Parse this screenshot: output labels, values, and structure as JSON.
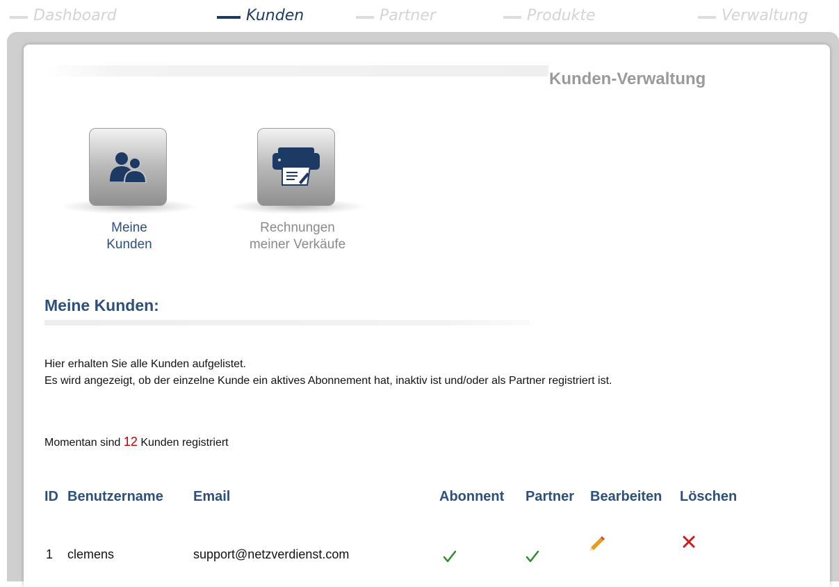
{
  "nav": {
    "items": [
      {
        "label": "Dashboard",
        "active": false
      },
      {
        "label": "Kunden",
        "active": true
      },
      {
        "label": "Partner",
        "active": false
      },
      {
        "label": "Produkte",
        "active": false
      },
      {
        "label": "Verwaltung",
        "active": false
      }
    ]
  },
  "page": {
    "title": "Kunden-Verwaltung"
  },
  "tiles": [
    {
      "label": "Meine\nKunden",
      "icon": "users-icon",
      "active": true
    },
    {
      "label": "Rechnungen\nmeiner Verkäufe",
      "icon": "printer-icon",
      "active": false
    }
  ],
  "section": {
    "title": "Meine Kunden:",
    "intro_line1": "Hier erhalten Sie alle Kunden aufgelistet.",
    "intro_line2": "Es wird angezeigt, ob der einzelne Kunde ein aktives Abonnement hat, inaktiv ist und/oder als Partner registriert ist.",
    "count_prefix": "Momentan sind",
    "count": "12",
    "count_suffix": "Kunden registriert"
  },
  "table": {
    "headers": {
      "id": "ID",
      "username": "Benutzername",
      "email": "Email",
      "abonnent": "Abonnent",
      "partner": "Partner",
      "edit": "Bearbeiten",
      "delete": "Löschen"
    },
    "rows": [
      {
        "id": "1",
        "username": "clemens",
        "email": "support@netzverdienst.com",
        "abonnent": true,
        "partner": true,
        "edit_icon": "pencil-icon",
        "delete_icon": "delete-x-icon"
      }
    ]
  },
  "colors": {
    "accent": "#2d4f7c",
    "nav_active": "#1d3a64",
    "nav_inactive": "#d4d4d4",
    "count": "#c00000",
    "check": "#2e8b2e",
    "delete": "#d01818"
  }
}
